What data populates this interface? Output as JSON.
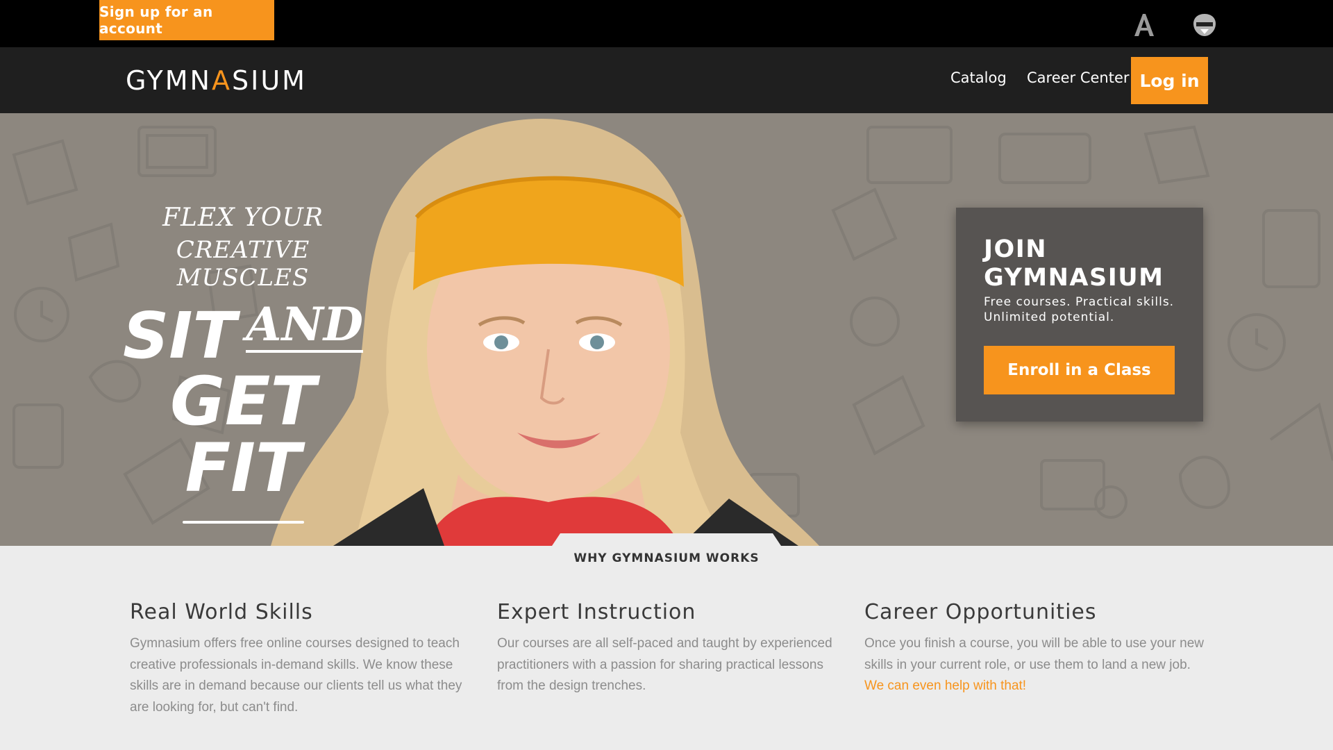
{
  "topbar": {
    "signup_label": "Sign up for an account",
    "icons": [
      "aquent-logo-icon",
      "vitamin-t-logo-icon"
    ]
  },
  "nav": {
    "logo_prefix": "GYMN",
    "logo_accent": "A",
    "logo_suffix": "SIUM",
    "links": [
      "Catalog",
      "Career Center"
    ],
    "login_label": "Log in"
  },
  "hero": {
    "slogan": {
      "line1": "FLEX YOUR",
      "line2": "CREATIVE MUSCLES",
      "sit": "SIT",
      "and": "AND",
      "getfit": "GET FIT"
    },
    "join": {
      "title": "JOIN GYMNASIUM",
      "subtitle": "Free courses. Practical skills. Unlimited potential.",
      "button": "Enroll in a Class"
    }
  },
  "why": {
    "heading": "WHY GYMNASIUM WORKS",
    "columns": [
      {
        "title": "Real World Skills",
        "text": "Gymnasium offers free online courses designed to teach creative professionals in-demand skills. We know these skills are in demand because our clients tell us what they are looking for, but can't find."
      },
      {
        "title": "Expert Instruction",
        "text": "Our courses are all self-paced and taught by experienced practitioners with a passion for sharing practical lessons from the design trenches."
      },
      {
        "title": "Career Opportunities",
        "text": "Once you finish a course, you will be able to use your new skills in your current role, or use them to land a new job.",
        "link": "We can even help with that!"
      }
    ]
  },
  "colors": {
    "accent": "#f7941d",
    "nav_bg": "#1f1f1f",
    "hero_bg": "#8d877f",
    "section_bg": "#ececec"
  }
}
